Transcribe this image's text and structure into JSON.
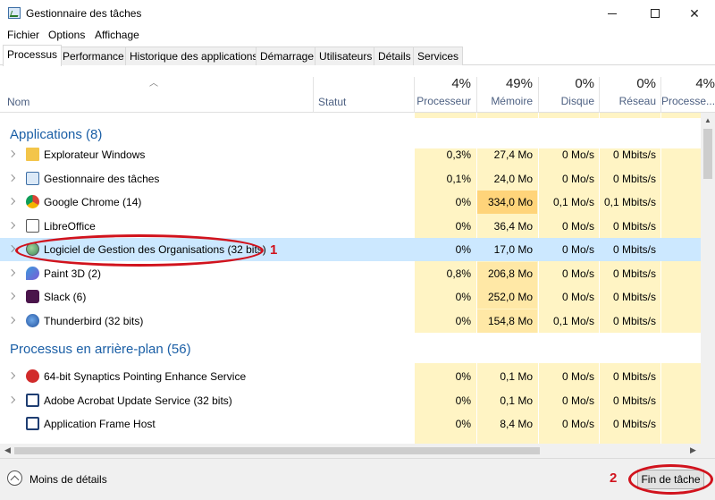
{
  "window": {
    "title": "Gestionnaire des tâches",
    "close_glyph": "✕"
  },
  "menu": [
    "Fichier",
    "Options",
    "Affichage"
  ],
  "tabs": [
    "Processus",
    "Performance",
    "Historique des applications",
    "Démarrage",
    "Utilisateurs",
    "Détails",
    "Services"
  ],
  "active_tab": "Processus",
  "columns": {
    "name": "Nom",
    "status": "Statut",
    "cpu": {
      "pct": "4%",
      "label": "Processeur"
    },
    "mem": {
      "pct": "49%",
      "label": "Mémoire"
    },
    "disk": {
      "pct": "0%",
      "label": "Disque"
    },
    "net": {
      "pct": "0%",
      "label": "Réseau"
    },
    "gpu": {
      "pct": "4%",
      "label": "Processe..."
    }
  },
  "groups": {
    "apps": "Applications (8)",
    "background": "Processus en arrière-plan (56)"
  },
  "apps": [
    {
      "name": "Explorateur Windows",
      "icon": "folder-icon",
      "cpu": "0,3%",
      "mem": "27,4 Mo",
      "disk": "0 Mo/s",
      "net": "0 Mbits/s",
      "expandable": true
    },
    {
      "name": "Gestionnaire des tâches",
      "icon": "task-manager-icon",
      "cpu": "0,1%",
      "mem": "24,0 Mo",
      "disk": "0 Mo/s",
      "net": "0 Mbits/s",
      "expandable": true
    },
    {
      "name": "Google Chrome (14)",
      "icon": "chrome-icon",
      "cpu": "0%",
      "mem": "334,0 Mo",
      "disk": "0,1 Mo/s",
      "net": "0,1 Mbits/s",
      "expandable": true
    },
    {
      "name": "LibreOffice",
      "icon": "document-icon",
      "cpu": "0%",
      "mem": "36,4 Mo",
      "disk": "0 Mo/s",
      "net": "0 Mbits/s",
      "expandable": true
    },
    {
      "name": "Logiciel de Gestion des Organisations (32 bits)",
      "icon": "globe-icon",
      "cpu": "0%",
      "mem": "17,0 Mo",
      "disk": "0 Mo/s",
      "net": "0 Mbits/s",
      "expandable": true,
      "selected": true
    },
    {
      "name": "Paint 3D (2)",
      "icon": "paint3d-icon",
      "cpu": "0,8%",
      "mem": "206,8 Mo",
      "disk": "0 Mo/s",
      "net": "0 Mbits/s",
      "expandable": true
    },
    {
      "name": "Slack (6)",
      "icon": "slack-icon",
      "cpu": "0%",
      "mem": "252,0 Mo",
      "disk": "0 Mo/s",
      "net": "0 Mbits/s",
      "expandable": true
    },
    {
      "name": "Thunderbird (32 bits)",
      "icon": "thunderbird-icon",
      "cpu": "0%",
      "mem": "154,8 Mo",
      "disk": "0,1 Mo/s",
      "net": "0 Mbits/s",
      "expandable": true
    }
  ],
  "background": [
    {
      "name": "64-bit Synaptics Pointing Enhance Service",
      "icon": "synaptics-icon",
      "cpu": "0%",
      "mem": "0,1 Mo",
      "disk": "0 Mo/s",
      "net": "0 Mbits/s",
      "expandable": true
    },
    {
      "name": "Adobe Acrobat Update Service (32 bits)",
      "icon": "window-icon",
      "cpu": "0%",
      "mem": "0,1 Mo",
      "disk": "0 Mo/s",
      "net": "0 Mbits/s",
      "expandable": true
    },
    {
      "name": "Application Frame Host",
      "icon": "window-icon",
      "cpu": "0%",
      "mem": "8,4 Mo",
      "disk": "0 Mo/s",
      "net": "0 Mbits/s",
      "expandable": false
    }
  ],
  "footer": {
    "fewer_details": "Moins de détails",
    "end_task": "Fin de tâche"
  },
  "annotations": [
    "1",
    "2"
  ],
  "colors": {
    "annotation": "#d1131d",
    "heat_light": "#fff4c4",
    "heat_mid": "#ffe8a6",
    "heat_strong": "#ffd47a",
    "selected_row": "#cce8ff",
    "group_title": "#1b5fa6"
  }
}
